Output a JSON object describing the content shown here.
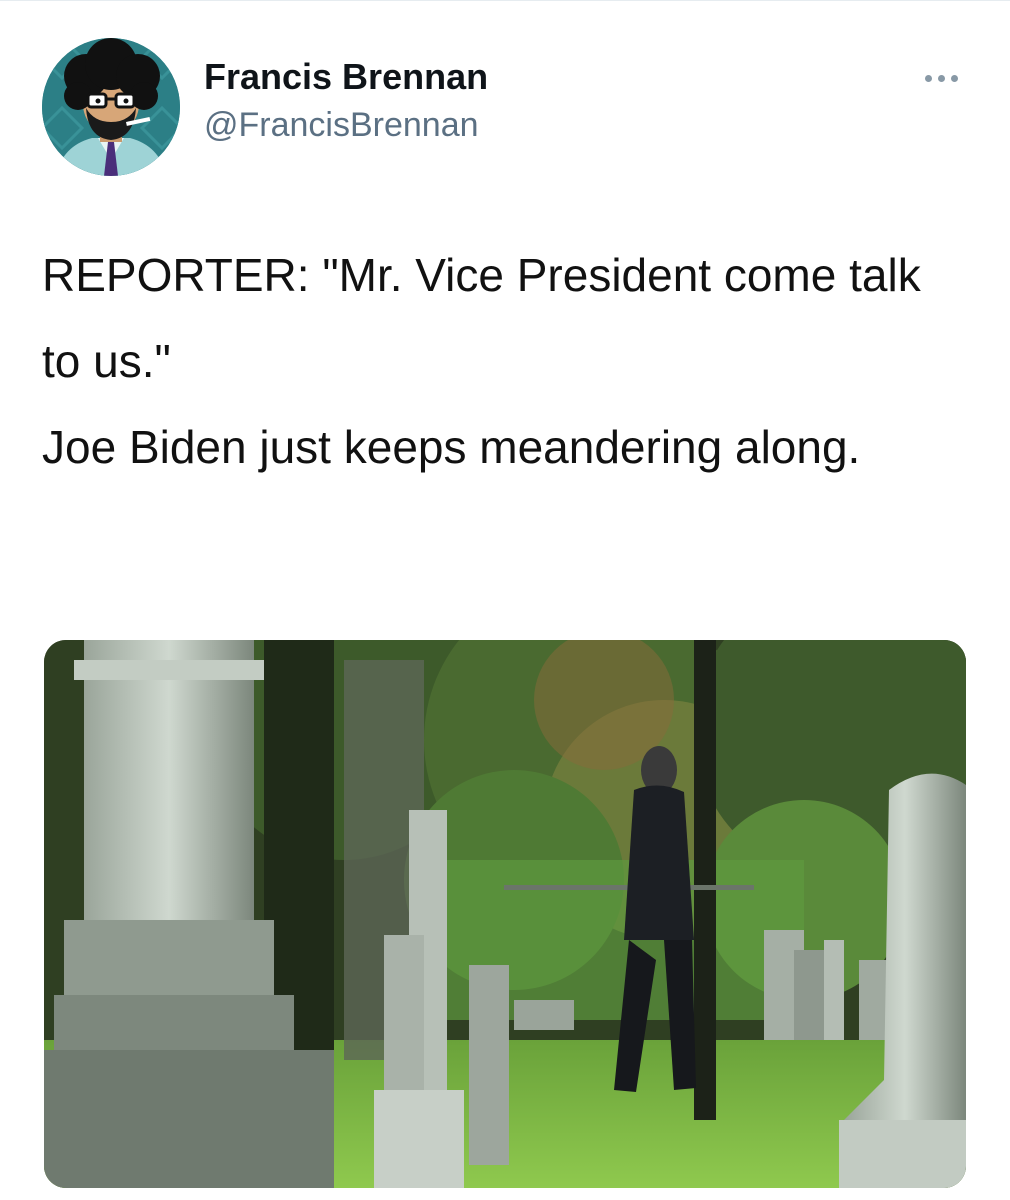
{
  "tweet": {
    "author": {
      "display_name": "Francis Brennan",
      "handle": "@FrancisBrennan"
    },
    "text_paragraphs": [
      "REPORTER: \"Mr. Vice President come talk to us.\"",
      "Joe Biden just keeps meandering along."
    ],
    "menu_icon": "more-horizontal-icon",
    "media_type": "video-still"
  },
  "colors": {
    "handle": "#5b7083",
    "name": "#0f1419",
    "divider": "#e6ecf0",
    "more_dots": "#8899a6"
  }
}
